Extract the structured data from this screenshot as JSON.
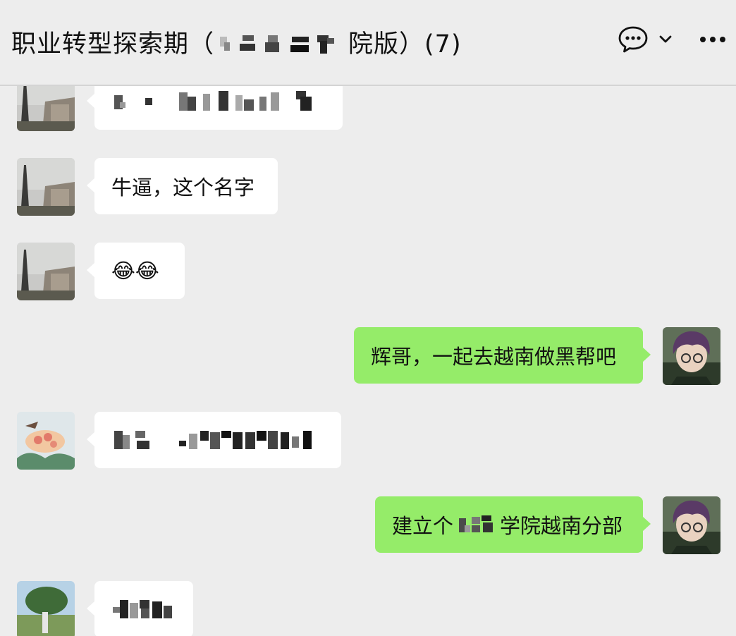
{
  "header": {
    "title_prefix": "职业转型探索期（",
    "title_suffix": "院版）(7)",
    "chat_icon": "chat-bubble-icon",
    "dropdown_icon": "chevron-down-icon",
    "more_icon": "more-icon"
  },
  "messages": [
    {
      "side": "left",
      "text": "",
      "redacted": true
    },
    {
      "side": "left",
      "text": "牛逼，这个名字"
    },
    {
      "side": "left",
      "text": "😂😂"
    },
    {
      "side": "right",
      "text": "辉哥，一起去越南做黑帮吧"
    },
    {
      "side": "left",
      "text": "",
      "redacted": true
    },
    {
      "side": "right",
      "text_prefix": "建立个",
      "text_suffix": "学院越南分部"
    },
    {
      "side": "left",
      "text": "",
      "redacted": true
    }
  ],
  "colors": {
    "background": "#ededed",
    "bubble_self": "#95ec69",
    "bubble_other": "#ffffff"
  }
}
